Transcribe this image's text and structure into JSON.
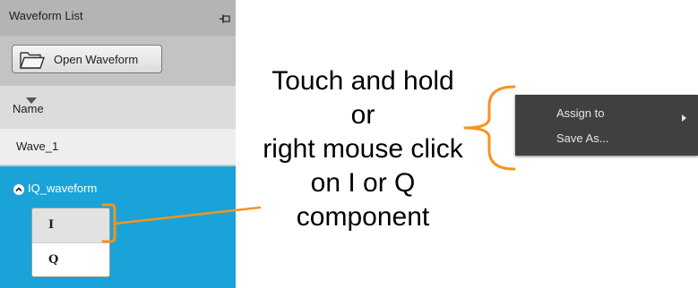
{
  "panel": {
    "title": "Waveform List",
    "pin_icon": "pin-icon",
    "open_button_label": "Open Waveform",
    "open_button_icon": "folder-icon",
    "column_header": "Name",
    "sort_icon": "sort-triangle-icon",
    "waveforms": [
      {
        "label": "Wave_1"
      },
      {
        "label": "IQ_waveform",
        "expanded": true,
        "selected": true,
        "components": [
          "I",
          "Q"
        ]
      }
    ]
  },
  "annotation": {
    "lines": [
      "Touch and hold",
      "or",
      "right mouse click",
      "on I or Q",
      "component"
    ],
    "callout_color": "#f7931e"
  },
  "context_menu": {
    "items": [
      {
        "label": "Assign to",
        "has_submenu": true
      },
      {
        "label": "Save As..."
      }
    ]
  },
  "colors": {
    "selected_row": "#1aa3d8",
    "menu_background": "#404040",
    "callout": "#f7931e"
  }
}
